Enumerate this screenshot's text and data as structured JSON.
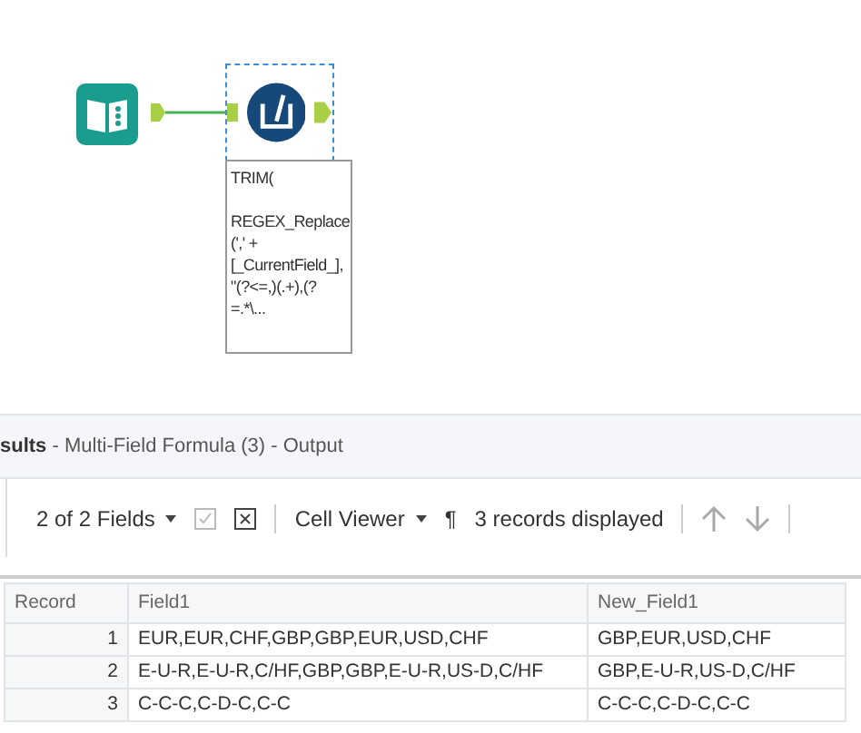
{
  "workflow": {
    "annotation": [
      [
        "TRIM("
      ],
      [
        "REGEX_Replace",
        "(',' +",
        "[_CurrentField_],",
        "\"(?<=,)(.+),(?",
        "=.*\\..."
      ]
    ],
    "tool_selected": true
  },
  "results": {
    "title_bold": "sults",
    "title_rest": " - Multi-Field Formula (3) - Output",
    "toolbar": {
      "fields": "2 of 2 Fields",
      "viewer": "Cell Viewer",
      "pilcrow": "¶",
      "records": "3 records displayed"
    },
    "table": {
      "columns": [
        "Record",
        "Field1",
        "New_Field1"
      ],
      "rows": [
        [
          "1",
          "EUR,EUR,CHF,GBP,GBP,EUR,USD,CHF",
          "GBP,EUR,USD,CHF"
        ],
        [
          "2",
          "E-U-R,E-U-R,C/HF,GBP,GBP,E-U-R,US-D,C/HF",
          "GBP,E-U-R,US-D,C/HF"
        ],
        [
          "3",
          "C-C-C,C-D-C,C-C",
          "C-C-C,C-D-C,C-C"
        ]
      ]
    }
  }
}
